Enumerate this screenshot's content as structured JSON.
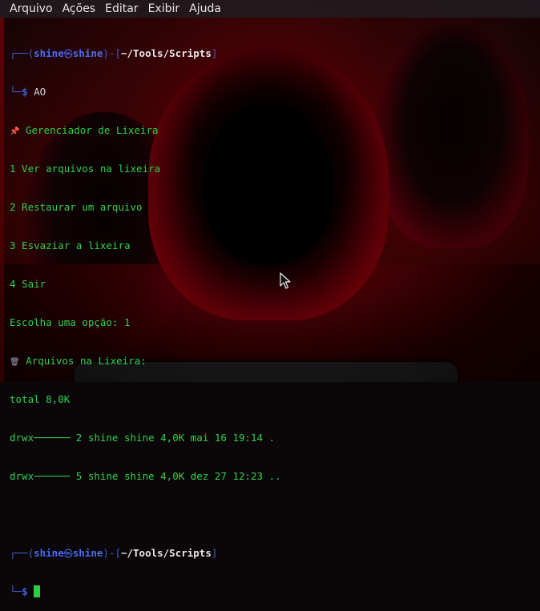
{
  "menu": [
    "Arquivo",
    "Ações",
    "Editar",
    "Exibir",
    "Ajuda"
  ],
  "prompt": {
    "top_frame": "┌──(",
    "user": "shine",
    "at_symbol": "㉿",
    "host": "shine",
    "mid_frame": ")-[",
    "path": "~/Tools/Scripts",
    "end_frame": "]",
    "bottom_frame": "└─",
    "dollar": "$"
  },
  "first_command": "AO",
  "output": {
    "title": "Gerenciador de Lixeira",
    "options": [
      "1 Ver arquivos na lixeira",
      "2 Restaurar um arquivo",
      "3 Esvaziar a lixeira",
      "4 Sair"
    ],
    "choice": "Escolha uma opção: 1",
    "files_title": "Arquivos na Lixeira:",
    "total": "total 8,0K",
    "listing": [
      "drwx────── 2 shine shine 4,0K mai 16 19:14 .",
      "drwx────── 5 shine shine 4,0K dez 27 12:23 .."
    ]
  },
  "icons": [
    "pushpin-icon",
    "trash-icon",
    "mouse-pointer-icon"
  ],
  "colors": {
    "prompt_blue": "#4a6cf0",
    "text_green": "#2fd24b",
    "cursor_green": "#27d13d"
  }
}
